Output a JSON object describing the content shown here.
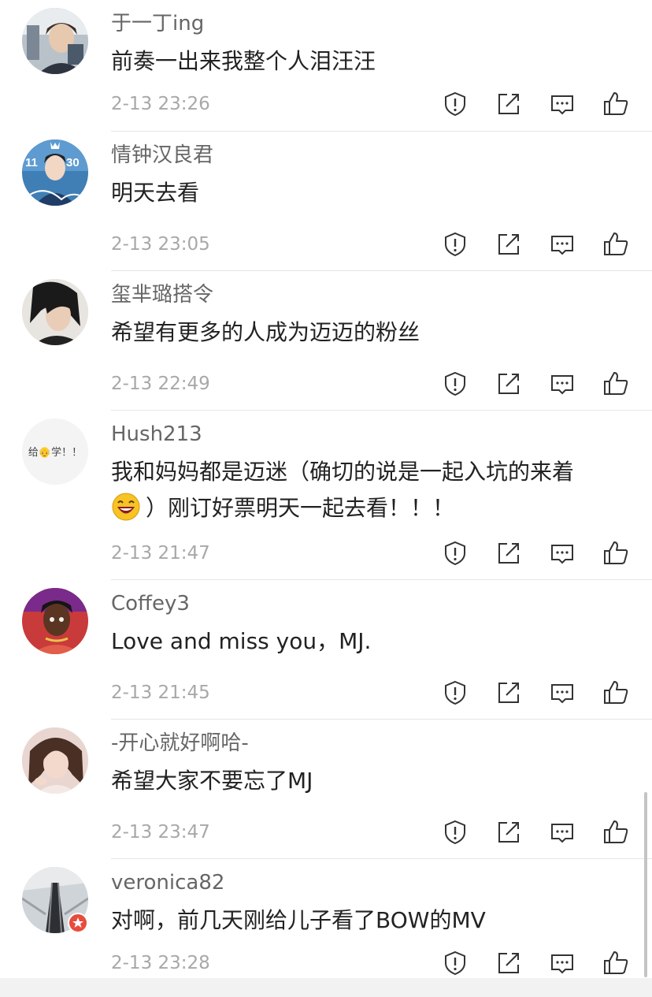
{
  "comments": [
    {
      "username": "于一丁ing",
      "text_line1": "前奏一出来我整个人泪汪汪",
      "text_line2": "",
      "timestamp": "2-13 23:26"
    },
    {
      "username": "情钟汉良君",
      "text_line1": "明天去看",
      "text_line2": "",
      "timestamp": "2-13 23:05",
      "avatar_text_left": "11",
      "avatar_text_right": "30"
    },
    {
      "username": "玺芈璐搭令",
      "text_line1": "希望有更多的人成为迈迈的粉丝",
      "text_line2": "",
      "timestamp": "2-13 22:49"
    },
    {
      "username": "Hush213",
      "text_line1": "我和妈妈都是迈迷（确切的说是一起入坑的来着",
      "text_line2": "）刚订好票明天一起去看！！！",
      "timestamp": "2-13 21:47",
      "avatar_text": "给👴学！！"
    },
    {
      "username": "Coffey3",
      "text_line1": "Love and miss you，MJ.",
      "text_line2": "",
      "timestamp": "2-13 21:45"
    },
    {
      "username": "-开心就好啊哈-",
      "text_line1": "希望大家不要忘了MJ",
      "text_line2": "",
      "timestamp": "2-13 23:47"
    },
    {
      "username": "veronica82",
      "text_line1": "对啊，前几天刚给儿子看了BOW的MV",
      "text_line2": "",
      "timestamp": "2-13 23:28"
    }
  ],
  "icons": {
    "report": "warning-shield-icon",
    "share": "share-icon",
    "reply": "comment-icon",
    "like": "thumbs-up-icon",
    "emoji": "laughing-emoji-icon",
    "verified_badge": "star-badge-icon"
  },
  "colors": {
    "username": "#666666",
    "text": "#222222",
    "timestamp": "#a8a8a8",
    "icon": "#333333",
    "divider": "#e5e5e5",
    "badge": "#e74c3c"
  }
}
